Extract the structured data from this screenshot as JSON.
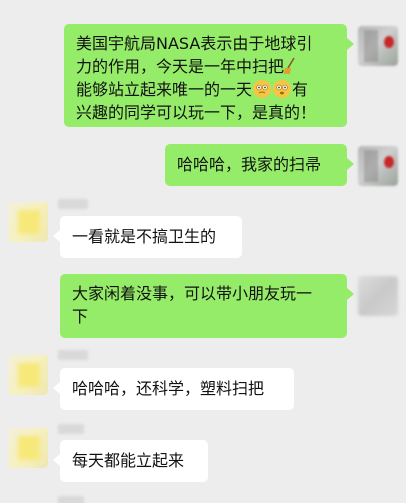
{
  "messages": [
    {
      "id": "m1",
      "side": "right",
      "lines": [
        "美国宇航局NASA表示由于地球引",
        "力的作用，今天是一年中扫把",
        "能够站立起来唯一的一天",
        "兴趣的同学可以玩一下，是真的！"
      ],
      "line3_suffix": "有",
      "icons": [
        "broom-icon",
        "emoji-icon",
        "emoji-icon"
      ]
    },
    {
      "id": "m2",
      "side": "right",
      "text": "哈哈哈，我家的扫帚"
    },
    {
      "id": "m3",
      "side": "left",
      "text": "一看就是不搞卫生的"
    },
    {
      "id": "m4",
      "side": "right",
      "lines": [
        "大家闲着没事，可以带小朋友玩一",
        "下"
      ]
    },
    {
      "id": "m5",
      "side": "left",
      "text": "哈哈哈，还科学，塑料扫把"
    },
    {
      "id": "m6",
      "side": "left",
      "text": "每天都能立起来"
    }
  ],
  "colors": {
    "background": "#ededed",
    "self_bubble": "#95ec69",
    "other_bubble": "#ffffff"
  }
}
